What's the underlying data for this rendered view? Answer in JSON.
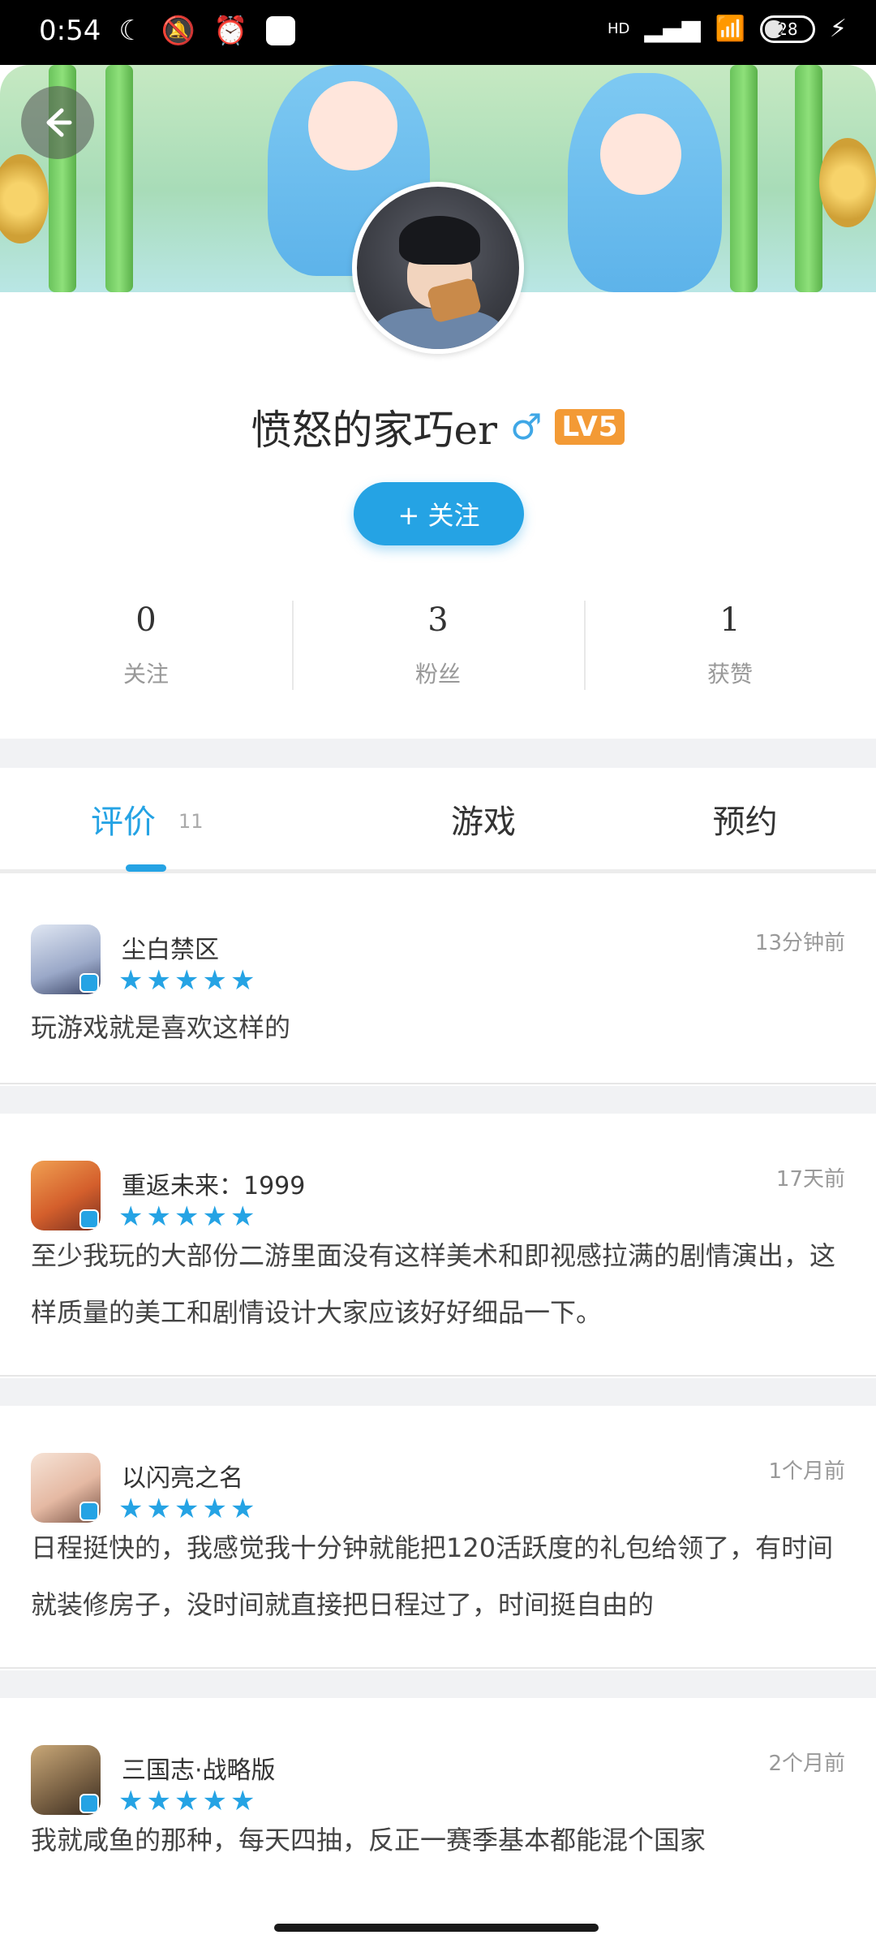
{
  "status_bar": {
    "time": "0:54",
    "net": "HD",
    "battery": "28"
  },
  "profile": {
    "username": "愤怒的家巧er",
    "gender_symbol": "♂",
    "level": "LV5",
    "follow_label": "+ 关注"
  },
  "stats": [
    {
      "value": "0",
      "label": "关注"
    },
    {
      "value": "3",
      "label": "粉丝"
    },
    {
      "value": "1",
      "label": "获赞"
    }
  ],
  "tabs": [
    {
      "label": "评价",
      "count": "11"
    },
    {
      "label": "游戏",
      "count": ""
    },
    {
      "label": "预约",
      "count": ""
    }
  ],
  "reviews": [
    {
      "game": "尘白禁区",
      "time": "13分钟前",
      "rating": 5,
      "text": "玩游戏就是喜欢这样的"
    },
    {
      "game": "重返未来：1999",
      "time": "17天前",
      "rating": 5,
      "text": "至少我玩的大部份二游里面没有这样美术和即视感拉满的剧情演出，这样质量的美工和剧情设计大家应该好好细品一下。"
    },
    {
      "game": "以闪亮之名",
      "time": "1个月前",
      "rating": 5,
      "text": "日程挺快的，我感觉我十分钟就能把120活跃度的礼包给领了，有时间就装修房子，没时间就直接把日程过了，时间挺自由的"
    },
    {
      "game": "三国志·战略版",
      "time": "2个月前",
      "rating": 5,
      "text": "我就咸鱼的那种，每天四抽，反正一赛季基本都能混个国家"
    }
  ],
  "colors": {
    "accent": "#25a3e4",
    "level_badge": "#f39a35"
  },
  "icons": {
    "back": "arrow-left-icon",
    "star": "star-icon"
  }
}
